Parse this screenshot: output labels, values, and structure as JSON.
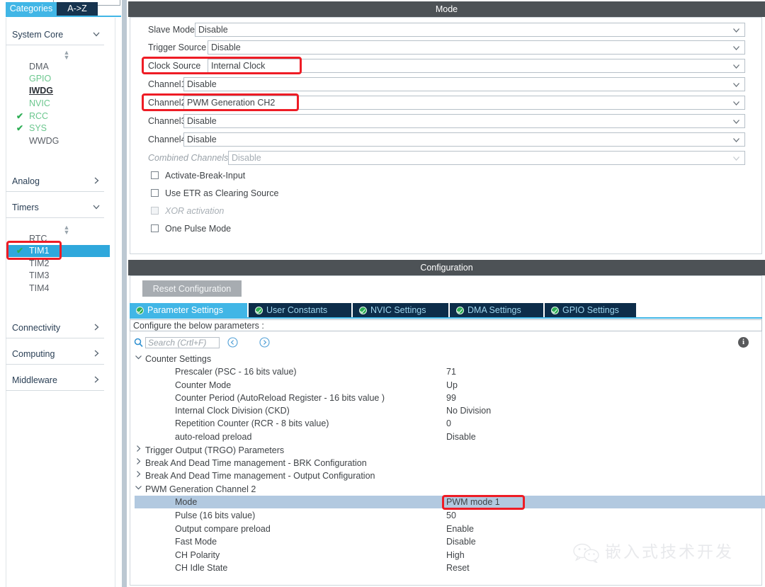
{
  "sidebar": {
    "tabs": [
      {
        "label": "Categories",
        "active": true
      },
      {
        "label": "A->Z",
        "active": false
      }
    ],
    "groups": [
      {
        "label": "System Core",
        "expanded": true,
        "items": [
          {
            "label": "DMA",
            "state": "plain",
            "checked": false
          },
          {
            "label": "GPIO",
            "state": "green",
            "checked": false
          },
          {
            "label": "IWDG",
            "state": "bold",
            "checked": false
          },
          {
            "label": "NVIC",
            "state": "green",
            "checked": false
          },
          {
            "label": "RCC",
            "state": "green",
            "checked": true
          },
          {
            "label": "SYS",
            "state": "green",
            "checked": true
          },
          {
            "label": "WWDG",
            "state": "plain",
            "checked": false
          }
        ]
      },
      {
        "label": "Analog",
        "expanded": false,
        "items": []
      },
      {
        "label": "Timers",
        "expanded": true,
        "items": [
          {
            "label": "RTC",
            "state": "plain",
            "checked": false,
            "selected": false
          },
          {
            "label": "TIM1",
            "state": "plain",
            "checked": true,
            "selected": true
          },
          {
            "label": "TIM2",
            "state": "plain",
            "checked": false,
            "selected": false
          },
          {
            "label": "TIM3",
            "state": "plain",
            "checked": false,
            "selected": false
          },
          {
            "label": "TIM4",
            "state": "plain",
            "checked": false,
            "selected": false
          }
        ]
      },
      {
        "label": "Connectivity",
        "expanded": false,
        "items": []
      },
      {
        "label": "Computing",
        "expanded": false,
        "items": []
      },
      {
        "label": "Middleware",
        "expanded": false,
        "items": []
      }
    ]
  },
  "mode_panel": {
    "title": "Mode",
    "rows": [
      {
        "label": "Slave Mode",
        "value": "Disable",
        "disabled": false,
        "highlighted": false
      },
      {
        "label": "Trigger Source",
        "value": "Disable",
        "disabled": false,
        "highlighted": false
      },
      {
        "label": "Clock Source",
        "value": "Internal Clock",
        "disabled": false,
        "highlighted": true
      },
      {
        "label": "Channel1",
        "value": "Disable",
        "disabled": false,
        "highlighted": false
      },
      {
        "label": "Channel2",
        "value": "PWM Generation CH2",
        "disabled": false,
        "highlighted": true
      },
      {
        "label": "Channel3",
        "value": "Disable",
        "disabled": false,
        "highlighted": false
      },
      {
        "label": "Channel4",
        "value": "Disable",
        "disabled": false,
        "highlighted": false
      },
      {
        "label": "Combined Channels",
        "value": "Disable",
        "disabled": true,
        "highlighted": false
      }
    ],
    "checkboxes": [
      {
        "label": "Activate-Break-Input",
        "checked": false,
        "disabled": false
      },
      {
        "label": "Use ETR as Clearing Source",
        "checked": false,
        "disabled": false
      },
      {
        "label": "XOR activation",
        "checked": false,
        "disabled": true
      },
      {
        "label": "One Pulse Mode",
        "checked": false,
        "disabled": false
      }
    ]
  },
  "config_panel": {
    "title": "Configuration",
    "reset_label": "Reset Configuration",
    "tabs": [
      {
        "label": "Parameter Settings",
        "active": true
      },
      {
        "label": "User Constants",
        "active": false
      },
      {
        "label": "NVIC Settings",
        "active": false
      },
      {
        "label": "DMA Settings",
        "active": false
      },
      {
        "label": "GPIO Settings",
        "active": false
      }
    ],
    "hint": "Configure the below parameters :",
    "search_placeholder": "Search (Crtl+F)",
    "search_value": "",
    "info_glyph": "i",
    "tree": [
      {
        "type": "group",
        "label": "Counter Settings",
        "expanded": true,
        "params": [
          {
            "name": "Prescaler (PSC - 16 bits value)",
            "value": "71",
            "selected": false
          },
          {
            "name": "Counter Mode",
            "value": "Up",
            "selected": false
          },
          {
            "name": "Counter Period (AutoReload Register - 16 bits value )",
            "value": "99",
            "selected": false
          },
          {
            "name": "Internal Clock Division (CKD)",
            "value": "No Division",
            "selected": false
          },
          {
            "name": "Repetition Counter (RCR - 8 bits value)",
            "value": "0",
            "selected": false
          },
          {
            "name": "auto-reload preload",
            "value": "Disable",
            "selected": false
          }
        ]
      },
      {
        "type": "group",
        "label": "Trigger Output (TRGO) Parameters",
        "expanded": false,
        "params": []
      },
      {
        "type": "group",
        "label": "Break And Dead Time management - BRK Configuration",
        "expanded": false,
        "params": []
      },
      {
        "type": "group",
        "label": "Break And Dead Time management - Output Configuration",
        "expanded": false,
        "params": []
      },
      {
        "type": "group",
        "label": "PWM Generation Channel 2",
        "expanded": true,
        "params": [
          {
            "name": "Mode",
            "value": "PWM mode 1",
            "selected": true,
            "highlighted": true
          },
          {
            "name": "Pulse (16 bits value)",
            "value": "50",
            "selected": false
          },
          {
            "name": "Output compare preload",
            "value": "Enable",
            "selected": false
          },
          {
            "name": "Fast Mode",
            "value": "Disable",
            "selected": false
          },
          {
            "name": "CH Polarity",
            "value": "High",
            "selected": false
          },
          {
            "name": "CH Idle State",
            "value": "Reset",
            "selected": false
          }
        ]
      }
    ]
  },
  "watermark": {
    "text": "嵌入式技术开发",
    "logo": "wechat-icon"
  },
  "colors": {
    "accent_blue": "#41b6e6",
    "tab_dark": "#0d2d4a",
    "panel_header": "#4d5256",
    "selection_blue": "#b2c9e0",
    "sidebar_select": "#2fa8dc",
    "annotation_red": "#ee1c25",
    "check_green": "#2eae55"
  }
}
